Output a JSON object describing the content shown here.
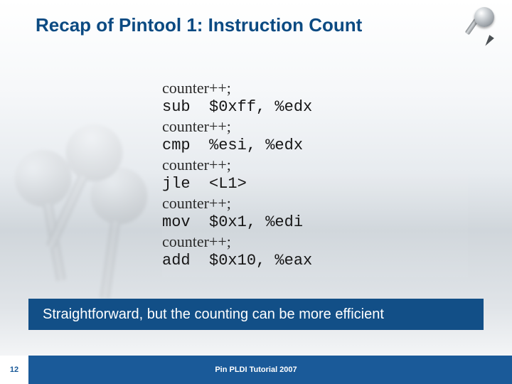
{
  "title": "Recap of Pintool 1: Instruction Count",
  "code": {
    "lines": [
      {
        "kind": "counter",
        "text": "counter++;"
      },
      {
        "kind": "asm",
        "text": "sub  $0xff, %edx"
      },
      {
        "kind": "counter",
        "text": "counter++;"
      },
      {
        "kind": "asm",
        "text": "cmp  %esi, %edx"
      },
      {
        "kind": "counter",
        "text": "counter++;"
      },
      {
        "kind": "asm",
        "text": "jle  <L1>"
      },
      {
        "kind": "counter",
        "text": "counter++;"
      },
      {
        "kind": "asm",
        "text": "mov  $0x1, %edi"
      },
      {
        "kind": "counter",
        "text": "counter++;"
      },
      {
        "kind": "asm",
        "text": "add  $0x10, %eax"
      }
    ]
  },
  "callout": "Straightforward, but the counting can be more efficient",
  "footer": {
    "page_number": "12",
    "text": "Pin PLDI Tutorial 2007"
  }
}
